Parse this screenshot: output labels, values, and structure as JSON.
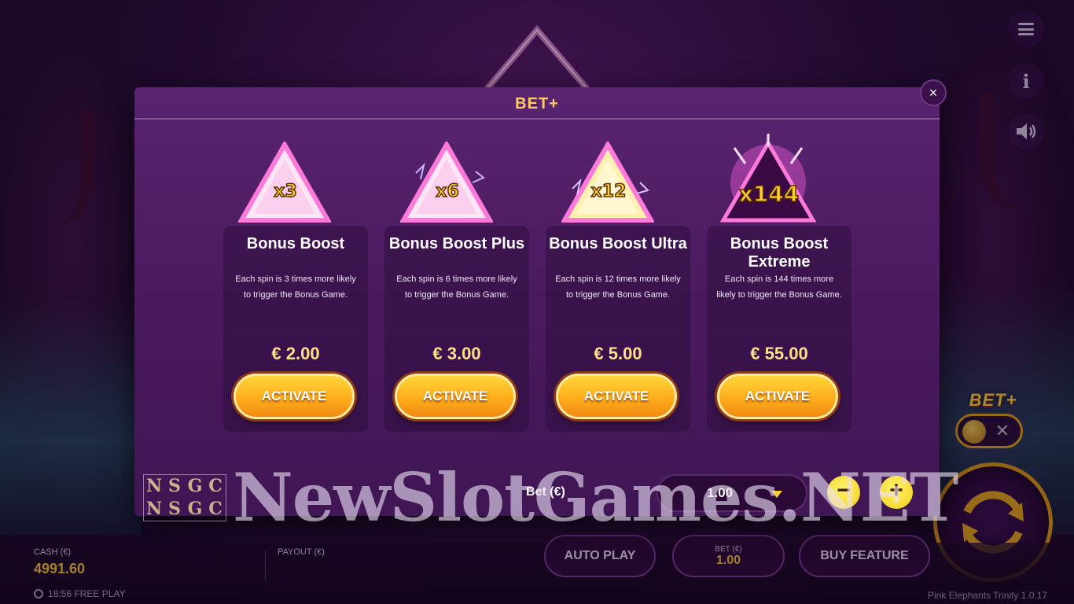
{
  "modal": {
    "title": "BET+",
    "close_label": "×",
    "cards": [
      {
        "multiplier": "x3",
        "name": "Bonus Boost",
        "description": "Each spin is 3 times more likely to trigger the Bonus Game.",
        "price": "€ 2.00",
        "button": "ACTIVATE"
      },
      {
        "multiplier": "x6",
        "name": "Bonus Boost Plus",
        "description": "Each spin is 6 times more likely to trigger the Bonus Game.",
        "price": "€ 3.00",
        "button": "ACTIVATE"
      },
      {
        "multiplier": "x12",
        "name": "Bonus Boost Ultra",
        "description": "Each spin is 12 times more likely to trigger the Bonus Game.",
        "price": "€ 5.00",
        "button": "ACTIVATE"
      },
      {
        "multiplier": "x144",
        "name": "Bonus Boost Extreme",
        "description": "Each spin is 144 times more likely to trigger the Bonus Game.",
        "price": "€ 55.00",
        "button": "ACTIVATE"
      }
    ],
    "bet": {
      "label": "Bet (€)",
      "value": "1.00",
      "minus": "−",
      "plus": "+"
    }
  },
  "side": {
    "betplus_label": "BET+",
    "betplus_toggle_off": "✕",
    "info": "i"
  },
  "bottom": {
    "cash_label": "CASH (€)",
    "cash_value": "4991.60",
    "clock": "18:56 FREE PLAY",
    "payout_label": "PAYOUT (€)",
    "auto_play": "AUTO PLAY",
    "bet_label": "BET (€)",
    "bet_value": "1.00",
    "buy_feature": "BUY FEATURE",
    "version": "Pink Elephants Trinity  1.0.17"
  },
  "watermark": {
    "text": "NewSlotGames.NET",
    "logo": [
      "N",
      "S",
      "G",
      "C",
      "N",
      "S",
      "G",
      "C"
    ]
  },
  "colors": {
    "accent_gold": "#ffcc66",
    "button_orange": "#ffb11e",
    "modal_purple": "#4a1a5e"
  }
}
